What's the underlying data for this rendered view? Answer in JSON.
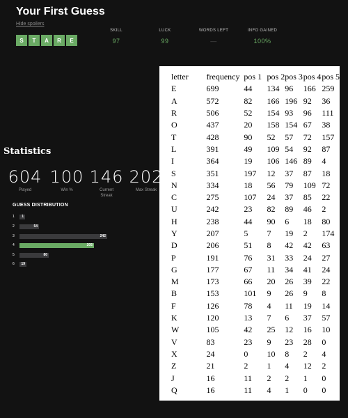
{
  "header": {
    "title": "Your First Guess",
    "hide_spoilers": "Hide spoilers",
    "guess_letters": [
      "S",
      "T",
      "A",
      "R",
      "E"
    ],
    "stats": [
      {
        "label": "SKILL",
        "value": "97"
      },
      {
        "label": "LUCK",
        "value": "99"
      },
      {
        "label": "WORDS LEFT",
        "value": "—"
      },
      {
        "label": "INFO GAINED",
        "value": "100%"
      }
    ],
    "accent_color": "#6aaa64"
  },
  "statistics": {
    "title": "Statistics",
    "summary": [
      {
        "value": "604",
        "label": "Played"
      },
      {
        "value": "100",
        "label": "Win %"
      },
      {
        "value": "146",
        "label": "Current Streak"
      },
      {
        "value": "202",
        "label": "Max Streak"
      }
    ],
    "distribution_title": "GUESS DISTRIBUTION",
    "distribution": [
      {
        "guess": "1",
        "count": 1,
        "highlight": false
      },
      {
        "guess": "2",
        "count": 54,
        "highlight": false
      },
      {
        "guess": "3",
        "count": 242,
        "highlight": false
      },
      {
        "guess": "4",
        "count": 205,
        "highlight": true
      },
      {
        "guess": "5",
        "count": 80,
        "highlight": false
      },
      {
        "guess": "6",
        "count": 19,
        "highlight": false
      }
    ]
  },
  "frequency_table": {
    "headers": [
      "letter",
      "frequency",
      "pos 1",
      "pos 2",
      "pos 3",
      "pos 4",
      "pos 5"
    ],
    "rows": [
      [
        "E",
        "699",
        "44",
        "134",
        "96",
        "166",
        "259"
      ],
      [
        "A",
        "572",
        "82",
        "166",
        "196",
        "92",
        "36"
      ],
      [
        "R",
        "506",
        "52",
        "154",
        "93",
        "96",
        "111"
      ],
      [
        "O",
        "437",
        "20",
        "158",
        "154",
        "67",
        "38"
      ],
      [
        "T",
        "428",
        "90",
        "52",
        "57",
        "72",
        "157"
      ],
      [
        "L",
        "391",
        "49",
        "109",
        "54",
        "92",
        "87"
      ],
      [
        "I",
        "364",
        "19",
        "106",
        "146",
        "89",
        "4"
      ],
      [
        "S",
        "351",
        "197",
        "12",
        "37",
        "87",
        "18"
      ],
      [
        "N",
        "334",
        "18",
        "56",
        "79",
        "109",
        "72"
      ],
      [
        "C",
        "275",
        "107",
        "24",
        "37",
        "85",
        "22"
      ],
      [
        "U",
        "242",
        "23",
        "82",
        "89",
        "46",
        "2"
      ],
      [
        "H",
        "238",
        "44",
        "90",
        "6",
        "18",
        "80"
      ],
      [
        "Y",
        "207",
        "5",
        "7",
        "19",
        "2",
        "174"
      ],
      [
        "D",
        "206",
        "51",
        "8",
        "42",
        "42",
        "63"
      ],
      [
        "P",
        "191",
        "76",
        "31",
        "33",
        "24",
        "27"
      ],
      [
        "G",
        "177",
        "67",
        "11",
        "34",
        "41",
        "24"
      ],
      [
        "M",
        "173",
        "66",
        "20",
        "26",
        "39",
        "22"
      ],
      [
        "B",
        "153",
        "101",
        "9",
        "26",
        "9",
        "8"
      ],
      [
        "F",
        "126",
        "78",
        "4",
        "11",
        "19",
        "14"
      ],
      [
        "K",
        "120",
        "13",
        "7",
        "6",
        "37",
        "57"
      ],
      [
        "W",
        "105",
        "42",
        "25",
        "12",
        "16",
        "10"
      ],
      [
        "V",
        "83",
        "23",
        "9",
        "23",
        "28",
        "0"
      ],
      [
        "X",
        "24",
        "0",
        "10",
        "8",
        "2",
        "4"
      ],
      [
        "Z",
        "21",
        "2",
        "1",
        "4",
        "12",
        "2"
      ],
      [
        "J",
        "16",
        "11",
        "2",
        "2",
        "1",
        "0"
      ],
      [
        "Q",
        "16",
        "11",
        "4",
        "1",
        "0",
        "0"
      ]
    ]
  }
}
